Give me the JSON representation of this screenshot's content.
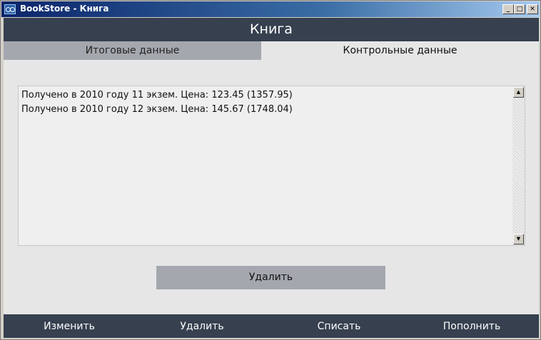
{
  "window": {
    "title": "BookStore - Книга",
    "icon": "bookstore-app-icon",
    "controls": {
      "minimize": "_",
      "maximize": "□",
      "close": "✕"
    }
  },
  "header": {
    "title": "Книга"
  },
  "tabs": [
    {
      "label": "Итоговые данные",
      "active": false
    },
    {
      "label": "Контрольные данные",
      "active": true
    }
  ],
  "records": [
    "Получено в 2010 году 11 экзем. Цена: 123.45 (1357.95)",
    "Получено в 2010 году 12 экзем. Цена: 145.67 (1748.04)"
  ],
  "scrollbar": {
    "up": "▲",
    "down": "▼"
  },
  "actions": {
    "delete_label": "Удалить"
  },
  "footer": {
    "buttons": [
      {
        "label": "Изменить"
      },
      {
        "label": "Удалить"
      },
      {
        "label": "Списать"
      },
      {
        "label": "Пополнить"
      }
    ]
  },
  "colors": {
    "header_bg": "#36404f",
    "tab_inactive_bg": "#a4a8ae",
    "content_bg": "#e6e6e6"
  }
}
